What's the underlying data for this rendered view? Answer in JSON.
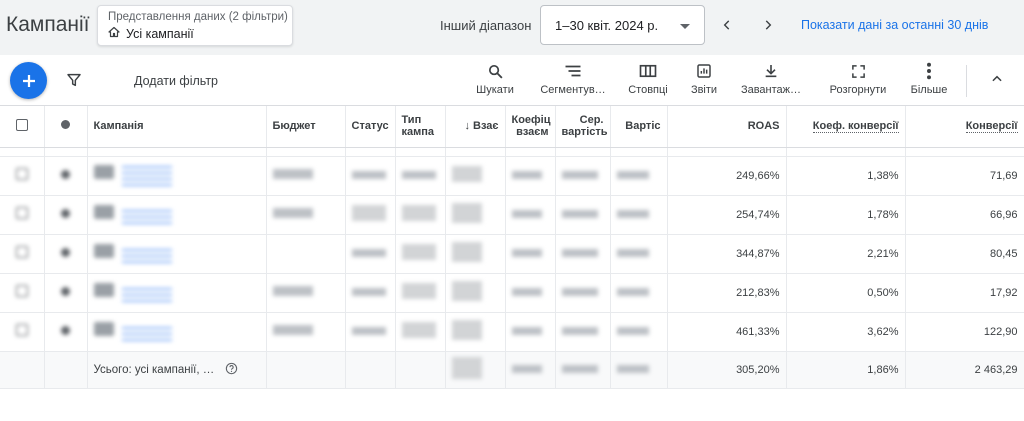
{
  "header": {
    "title": "Кампанії",
    "view_card": {
      "subtitle": "Представлення даних (2 фільтри)",
      "value": "Усі кампанії"
    },
    "range_label": "Інший діапазон",
    "date_range": "1–30 квіт. 2024 р.",
    "show_last_30": "Показати дані за останні 30 днів"
  },
  "toolbar": {
    "add_filter": "Додати фільтр",
    "tools": [
      {
        "label": "Шукати",
        "icon": "search-icon"
      },
      {
        "label": "Сегментув…",
        "icon": "segment-icon"
      },
      {
        "label": "Стовпці",
        "icon": "columns-icon"
      },
      {
        "label": "Звіти",
        "icon": "reports-icon"
      },
      {
        "label": "Завантаж…",
        "icon": "download-icon"
      },
      {
        "label": "Розгорнути",
        "icon": "expand-icon"
      },
      {
        "label": "Більше",
        "icon": "more-vert-icon"
      }
    ]
  },
  "table": {
    "columns": {
      "campaign": "Кампанія",
      "budget": "Бюджет",
      "status": "Статус",
      "type": "Тип кампа",
      "interactions": "Взає",
      "interaction_rate": "Коефіц взаєм",
      "avg_cost": "Сер. вартість",
      "cost": "Вартіс",
      "roas": "ROAS",
      "conv_rate": "Коеф. конверсії",
      "conversions": "Конверсії"
    },
    "rows": [
      {
        "roas": "249,66%",
        "conv_rate": "1,38%",
        "conversions": "71,69"
      },
      {
        "roas": "254,74%",
        "conv_rate": "1,78%",
        "conversions": "66,96"
      },
      {
        "roas": "344,87%",
        "conv_rate": "2,21%",
        "conversions": "80,45"
      },
      {
        "roas": "212,83%",
        "conv_rate": "0,50%",
        "conversions": "17,92"
      },
      {
        "roas": "461,33%",
        "conv_rate": "3,62%",
        "conversions": "122,90"
      }
    ],
    "total": {
      "label": "Усього: усі кампанії, …",
      "roas": "305,20%",
      "conv_rate": "1,86%",
      "conversions": "2 463,29"
    }
  },
  "colors": {
    "accent": "#1a73e8",
    "header_bg": "#f1f3f4",
    "total_bg": "#f8f9fa"
  }
}
